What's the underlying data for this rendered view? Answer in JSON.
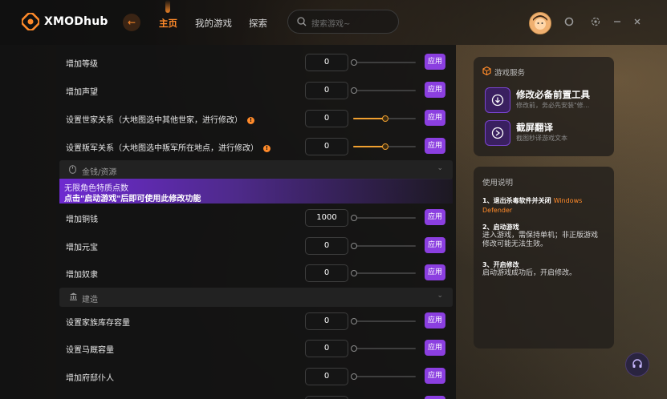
{
  "app": {
    "brand": "XMODhub"
  },
  "nav": {
    "items": [
      {
        "label": "主页",
        "active": true
      },
      {
        "label": "我的游戏",
        "active": false
      },
      {
        "label": "探索",
        "active": false
      }
    ]
  },
  "search": {
    "placeholder": "搜索游戏~"
  },
  "mods": {
    "apply_label": "应用",
    "rows_top": [
      {
        "label": "增加等级",
        "value": "0",
        "warn": false,
        "slider_fraction": 0
      },
      {
        "label": "增加声望",
        "value": "0",
        "warn": false,
        "slider_fraction": 0
      },
      {
        "label": "设置世家关系（大地图选中其他世家，进行修改）",
        "value": "0",
        "warn": true,
        "slider_fraction": 0.5
      },
      {
        "label": "设置叛军关系（大地图选中叛军所在地点，进行修改）",
        "value": "0",
        "warn": true,
        "slider_fraction": 0.5
      }
    ],
    "section_money": {
      "label": "金钱/资源"
    },
    "banner": {
      "line1": "无限角色特质点数",
      "line2": "点击\"启动游戏\"后即可使用此修改功能"
    },
    "rows_money": [
      {
        "label": "增加铜钱",
        "value": "1000",
        "warn": false,
        "slider_fraction": 0
      },
      {
        "label": "增加元宝",
        "value": "0",
        "warn": false,
        "slider_fraction": 0
      },
      {
        "label": "增加奴隶",
        "value": "0",
        "warn": false,
        "slider_fraction": 0
      }
    ],
    "section_build": {
      "label": "建造"
    },
    "rows_build": [
      {
        "label": "设置家族库存容量",
        "value": "0",
        "warn": false,
        "slider_fraction": 0
      },
      {
        "label": "设置马厩容量",
        "value": "0",
        "warn": false,
        "slider_fraction": 0
      },
      {
        "label": "增加府邸仆人",
        "value": "0",
        "warn": false,
        "slider_fraction": 0
      }
    ]
  },
  "services": {
    "title": "游戏服务",
    "items": [
      {
        "title": "修改必备前置工具",
        "subtitle": "修改前，务必先安装\"修..."
      },
      {
        "title": "截屏翻译",
        "subtitle": "截图秒译游戏文本"
      }
    ]
  },
  "usage": {
    "title": "使用说明",
    "steps": [
      {
        "title": "1、退出杀毒软件并关闭",
        "highlight": "Windows Defender",
        "body": ""
      },
      {
        "title": "2、启动游戏",
        "highlight": "",
        "body": "进入游戏，需保持单机；非正版游戏修改可能无法生效。"
      },
      {
        "title": "3、开启修改",
        "highlight": "",
        "body": "启动游戏成功后，开启修改。"
      }
    ]
  },
  "icons": {
    "window": [
      "power-icon",
      "settings-icon",
      "minimize-icon",
      "close-icon"
    ],
    "support": "headset-icon"
  },
  "colors": {
    "accent": "#ff8a2a",
    "apply": "#8b3fe0",
    "slider": "#f0a030"
  }
}
